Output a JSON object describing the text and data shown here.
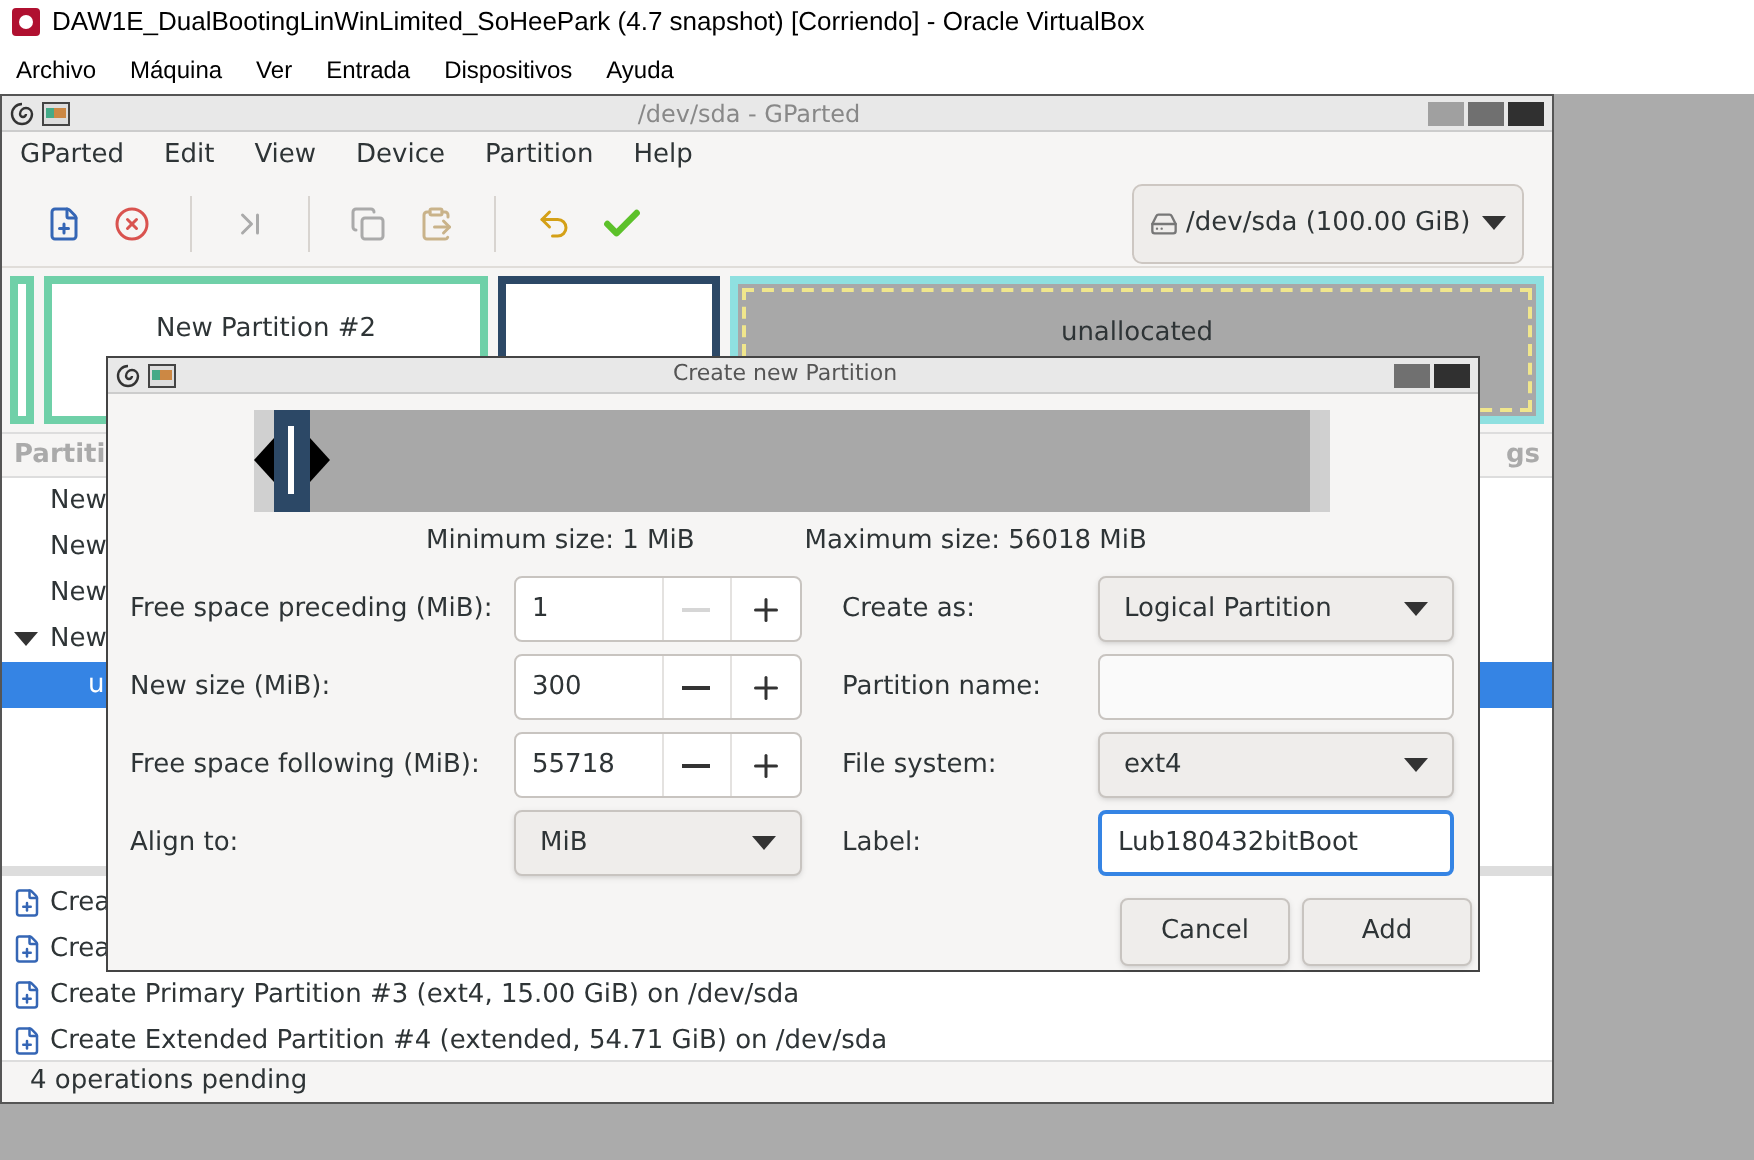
{
  "host_window": {
    "title": "DAW1E_DualBootingLinWinLimited_SoHeePark (4.7 snapshot) [Corriendo] - Oracle VirtualBox",
    "menu": [
      "Archivo",
      "Máquina",
      "Ver",
      "Entrada",
      "Dispositivos",
      "Ayuda"
    ]
  },
  "gparted": {
    "title": "/dev/sda - GParted",
    "menu": [
      "GParted",
      "Edit",
      "View",
      "Device",
      "Partition",
      "Help"
    ],
    "toolbar": [
      {
        "kind": "new",
        "disabled": false
      },
      {
        "kind": "delete",
        "disabled": false
      },
      {
        "kind": "sep"
      },
      {
        "kind": "resize",
        "disabled": true
      },
      {
        "kind": "sep"
      },
      {
        "kind": "copy",
        "disabled": true
      },
      {
        "kind": "paste",
        "disabled": true
      },
      {
        "kind": "sep"
      },
      {
        "kind": "undo",
        "disabled": false
      },
      {
        "kind": "apply",
        "disabled": false
      }
    ],
    "device": "/dev/sda (100.00 GiB)",
    "graph": [
      {
        "kind": "tiny",
        "color": "#6fd0a8"
      },
      {
        "kind": "part",
        "color": "#6fd0a8",
        "label": "New Partition #2"
      },
      {
        "kind": "part",
        "color": "#2c4866"
      },
      {
        "kind": "unallocated",
        "color": "#8fe0e0",
        "label": "unallocated"
      }
    ],
    "table": {
      "column_1": "Partiti",
      "column_last": "gs",
      "rows": [
        {
          "name": "New",
          "selected": false
        },
        {
          "name": "New",
          "selected": false
        },
        {
          "name": "New",
          "selected": false
        },
        {
          "name": "New",
          "selected": false,
          "expanded": true,
          "children": [
            {
              "name": "u",
              "selected": true
            }
          ]
        }
      ]
    },
    "operations": [
      "Crea",
      "Crea",
      "Create Primary Partition #3 (ext4, 15.00 GiB) on /dev/sda",
      "Create Extended Partition #4 (extended, 54.71 GiB) on /dev/sda"
    ],
    "status": "4 operations pending"
  },
  "dialog": {
    "title": "Create new Partition",
    "resizer": {
      "level": 0.035
    },
    "min_size": "Minimum size: 1 MiB",
    "max_size": "Maximum size: 56018 MiB",
    "left_fields": [
      {
        "kind": "spin",
        "label": "Free space preceding (MiB):",
        "value": "1",
        "minus_disabled": true
      },
      {
        "kind": "spin",
        "label": "New size (MiB):",
        "value": "300",
        "minus_disabled": false
      },
      {
        "kind": "spin",
        "label": "Free space following (MiB):",
        "value": "55718",
        "minus_disabled": false
      },
      {
        "kind": "combo",
        "label": "Align to:",
        "value": "MiB"
      }
    ],
    "right_fields": [
      {
        "kind": "combo",
        "label": "Create as:",
        "value": "Logical Partition"
      },
      {
        "kind": "entry",
        "label": "Partition name:",
        "focused": false
      },
      {
        "kind": "combo",
        "label": "File system:",
        "value": "ext4"
      },
      {
        "kind": "entry",
        "label": "Label:",
        "value": "Lub180432bitBoot",
        "focused": true
      }
    ],
    "buttons": [
      "Cancel",
      "Add"
    ]
  }
}
